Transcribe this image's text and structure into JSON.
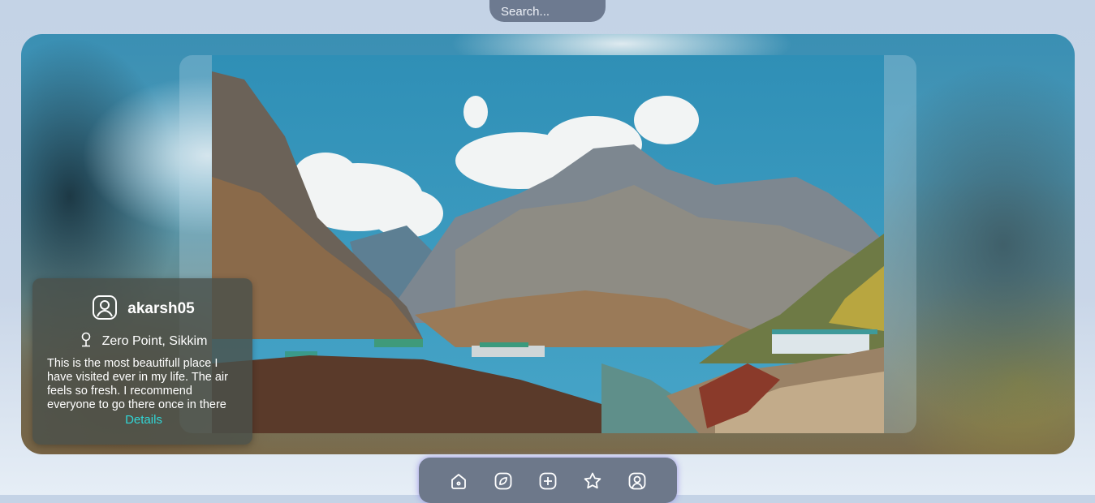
{
  "search": {
    "placeholder": "Search..."
  },
  "post": {
    "username": "akarsh05",
    "location": "Zero Point, Sikkim",
    "description": "This is the most beautifull place I have visited ever in my life. The air feels so fresh. I recommend everyone to go there once in there",
    "details_label": "Details"
  },
  "nav": {
    "items": [
      {
        "icon": "home-icon"
      },
      {
        "icon": "compass-icon"
      },
      {
        "icon": "add-square-icon"
      },
      {
        "icon": "star-icon"
      },
      {
        "icon": "profile-icon"
      }
    ]
  },
  "colors": {
    "accent_link": "#31d6d6",
    "nav_bar": "#6d788a",
    "search_bar": "#6d7a90"
  }
}
